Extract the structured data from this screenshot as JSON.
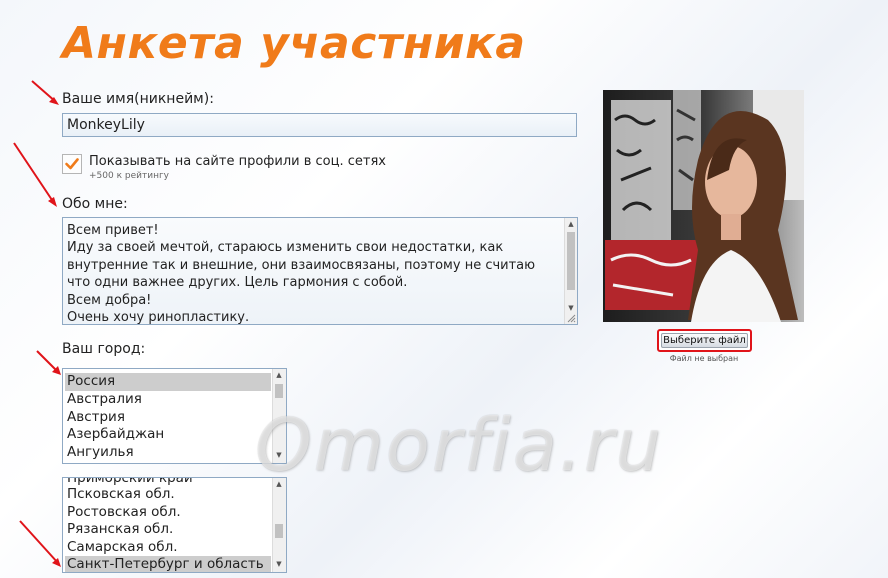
{
  "page": {
    "title": "Анкета участника"
  },
  "nickname": {
    "label": "Ваше имя(никнейм):",
    "value": "MonkeyLily"
  },
  "show_profiles": {
    "checked": true,
    "label": "Показывать на сайте профили в соц. сетях",
    "bonus": "+500 к рейтингу"
  },
  "about": {
    "label": "Обо мне:",
    "text": "Всем привет!\nИду за своей мечтой, стараюсь изменить свои недостатки, как внутренние так и внешние, они взаимосвязаны, поэтому не считаю что одни важнее других. Цель гармония с собой.\nВсем добра!\nОчень хочу ринопластику."
  },
  "city": {
    "label": "Ваш город:",
    "countries": [
      "Россия",
      "Австралия",
      "Австрия",
      "Азербайджан",
      "Ангуилья"
    ],
    "selected_country": "Россия",
    "regions": [
      "Приморский край",
      "Псковская обл.",
      "Ростовская обл.",
      "Рязанская обл.",
      "Самарская обл.",
      "Санкт-Петербург и область"
    ],
    "selected_region": "Санкт-Петербург и область"
  },
  "photo_upload": {
    "button_label": "Выберите файл",
    "status": "Файл не выбран"
  },
  "watermark": "Omorfia.ru",
  "colors": {
    "accent": "#f07b1a",
    "highlight_border": "#e0141a",
    "arrows": "#e0141a"
  }
}
